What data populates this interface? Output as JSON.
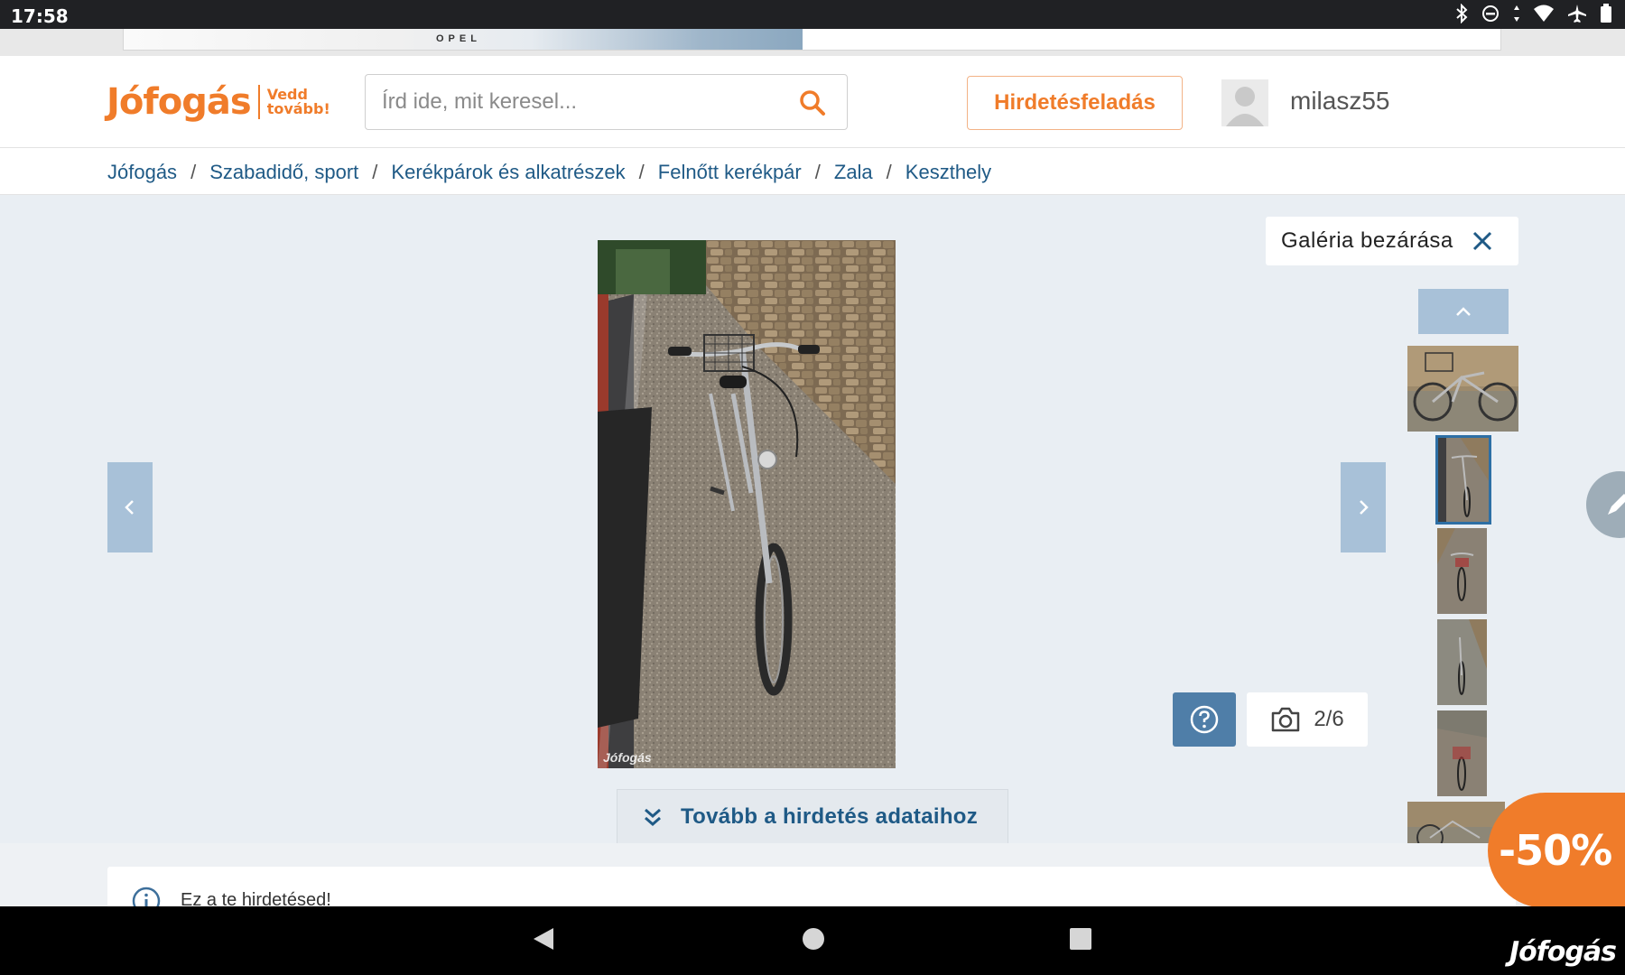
{
  "status_bar": {
    "time": "17:58",
    "icons": [
      "bluetooth-icon",
      "dnd-icon",
      "data-arrows-icon",
      "wifi-icon",
      "airplane-icon",
      "battery-icon"
    ]
  },
  "ad": {
    "brand": "OPEL"
  },
  "header": {
    "logo_name": "Jófogás",
    "logo_tag_line1": "Vedd",
    "logo_tag_line2": "tovább!",
    "search_placeholder": "Írd ide, mit keresel...",
    "post_ad_label": "Hirdetésfeladás",
    "username": "milasz55"
  },
  "breadcrumb": [
    "Jófogás",
    "Szabadidő, sport",
    "Kerékpárok és alkatrészek",
    "Felnőtt kerékpár",
    "Zala",
    "Keszthely"
  ],
  "gallery": {
    "close_label": "Galéria bezárása",
    "counter": "2/6",
    "watermark": "Jófogás",
    "more_details_label": "Tovább a hirdetés adataihoz",
    "thumbnails": [
      "bike-side-photo",
      "bike-front-photo",
      "bike-back-photo",
      "bike-front-2-photo",
      "bike-basket-photo",
      "bike-side-2-photo"
    ],
    "active_thumbnail": 2
  },
  "notice": {
    "text": "Ez a te hirdetésed!"
  },
  "discount_badge": "-50%",
  "corner_logo": "Jófogás",
  "colors": {
    "brand_orange": "#f07c2a",
    "link_blue": "#1f5a86",
    "gallery_bg": "#e9eef3",
    "control_blue": "#a8c1d8"
  }
}
